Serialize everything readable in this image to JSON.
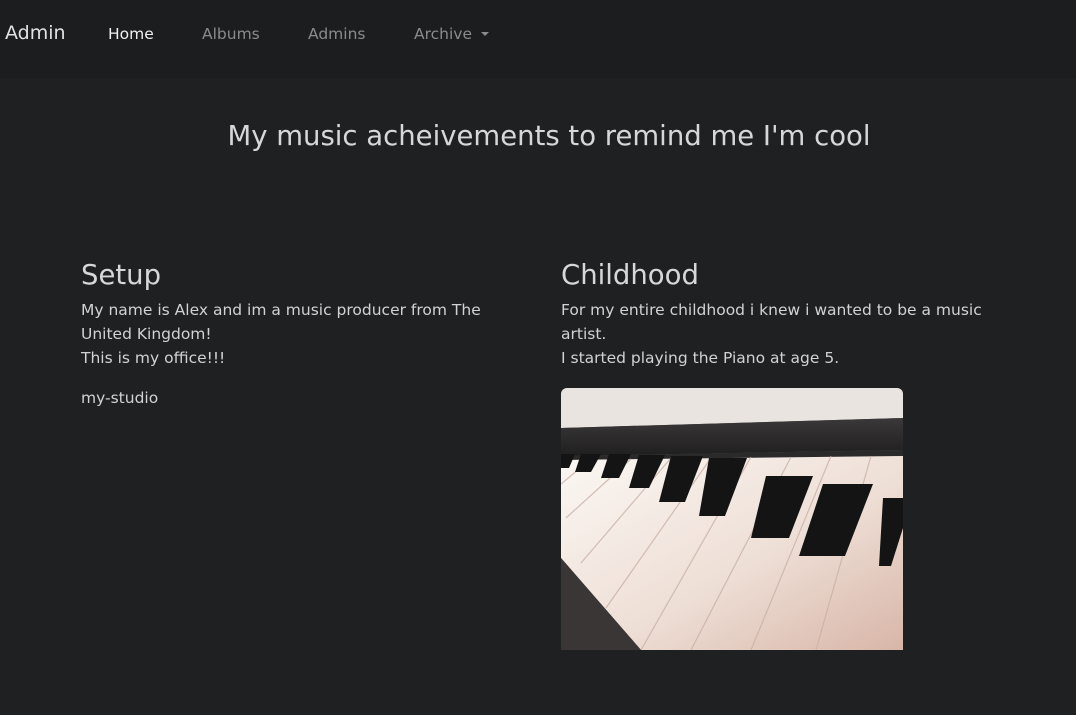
{
  "nav": {
    "brand": "Admin",
    "links": [
      "Home",
      "Albums",
      "Admins",
      "Archive"
    ]
  },
  "page_title": "My music acheivements to remind me I'm cool",
  "sections": {
    "setup": {
      "heading": "Setup",
      "lines": [
        "My name is Alex and im a music producer from The",
        "United Kingdom!",
        "This is my office!!!"
      ],
      "image_alt": "my-studio"
    },
    "childhood": {
      "heading": "Childhood",
      "lines": [
        "For my entire childhood i knew i wanted to be a music",
        "artist.",
        "I started playing the Piano at age 5."
      ]
    }
  },
  "colors": {
    "background": "#1f2022",
    "navbar": "#1c1d1f",
    "active_link": "#f0f0f0",
    "inactive_link": "#8a8b8d"
  }
}
